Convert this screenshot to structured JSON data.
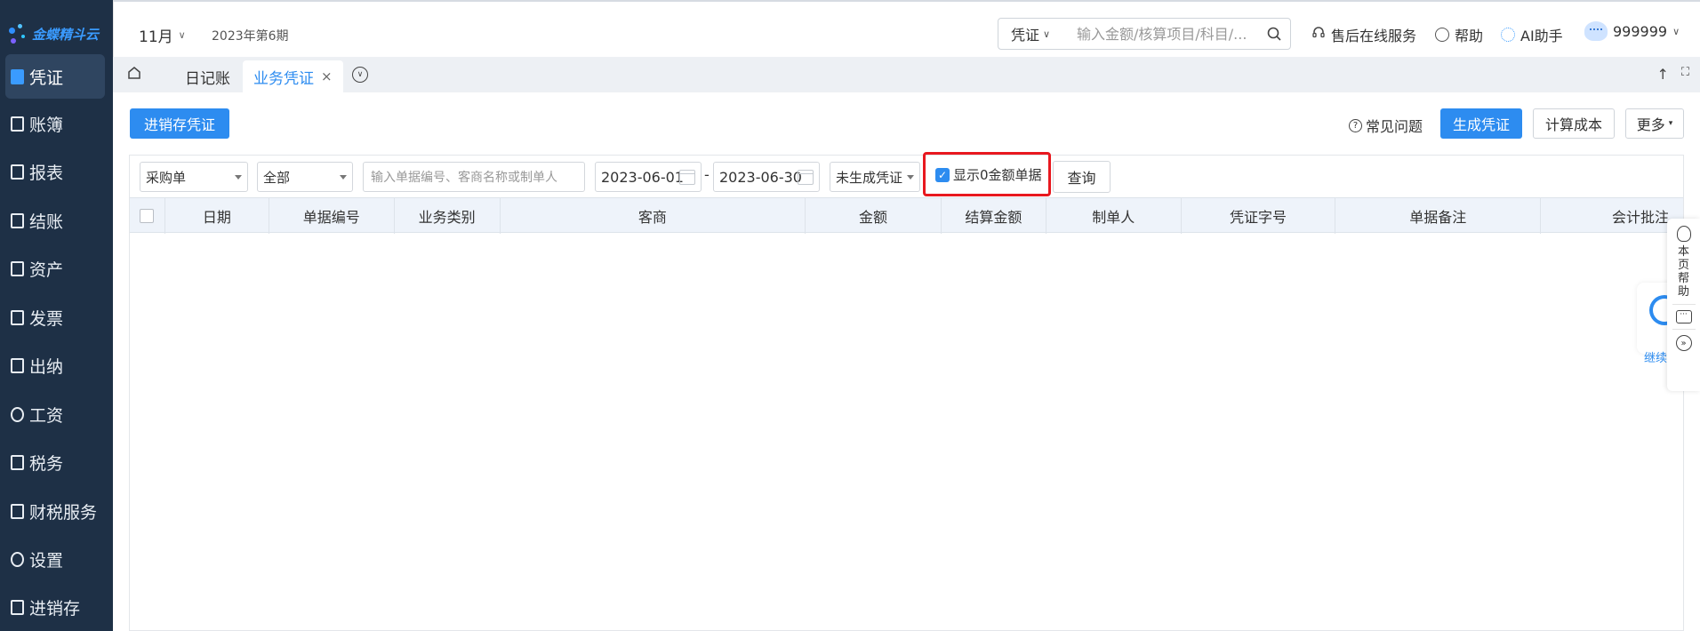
{
  "app": {
    "logo_text": "金蝶精斗云"
  },
  "sidebar": {
    "items": [
      {
        "label": "凭证",
        "icon": "voucher-icon",
        "active": true
      },
      {
        "label": "账簿",
        "icon": "ledger-icon"
      },
      {
        "label": "报表",
        "icon": "report-icon"
      },
      {
        "label": "结账",
        "icon": "closing-icon"
      },
      {
        "label": "资产",
        "icon": "asset-icon"
      },
      {
        "label": "发票",
        "icon": "invoice-icon"
      },
      {
        "label": "出纳",
        "icon": "cashier-icon"
      },
      {
        "label": "工资",
        "icon": "salary-icon"
      },
      {
        "label": "税务",
        "icon": "tax-icon"
      },
      {
        "label": "财税服务",
        "icon": "finance-service-icon"
      },
      {
        "label": "设置",
        "icon": "settings-icon"
      },
      {
        "label": "进销存",
        "icon": "inventory-icon"
      }
    ]
  },
  "header": {
    "period_month": "11月",
    "period_label": "2023年第6期",
    "search_type": "凭证",
    "search_placeholder": "输入金额/核算项目/科目/...",
    "service_label": "售后在线服务",
    "help_label": "帮助",
    "ai_label": "AI助手",
    "user_name": "999999"
  },
  "tabs": [
    {
      "label": "日记账",
      "active": false
    },
    {
      "label": "业务凭证",
      "active": true,
      "close": "×"
    }
  ],
  "tab_right": {
    "up": "↑",
    "fullscreen": "⛶"
  },
  "toolbar": {
    "inventory_voucher_label": "进销存凭证",
    "faq_label": "常见问题",
    "faq_icon": "?",
    "generate_label": "生成凭证",
    "calc_cost_label": "计算成本",
    "more_label": "更多"
  },
  "filters": {
    "doc_type": "采购单",
    "scope": "全部",
    "keyword_placeholder": "输入单据编号、客商名称或制单人",
    "date_from": "2023-06-01",
    "date_separator": "-",
    "date_to": "2023-06-30",
    "voucher_status": "未生成凭证",
    "show_zero_label": "显示0金额单据",
    "show_zero_checked": true,
    "query_label": "查询"
  },
  "table": {
    "columns": [
      "日期",
      "单据编号",
      "业务类别",
      "客商",
      "金额",
      "结算金额",
      "制单人",
      "凭证字号",
      "单据备注",
      "会计批注"
    ],
    "rows": []
  },
  "float_panel": {
    "page_help": "本页帮助",
    "chat_icon": "···",
    "expand_icon": "»"
  },
  "progress_widget": {
    "label": "继续",
    "progress": 0.75
  },
  "colors": {
    "sidebar_bg": "#1e3046",
    "accent": "#2d8cf0",
    "highlight": "#e8181f"
  }
}
